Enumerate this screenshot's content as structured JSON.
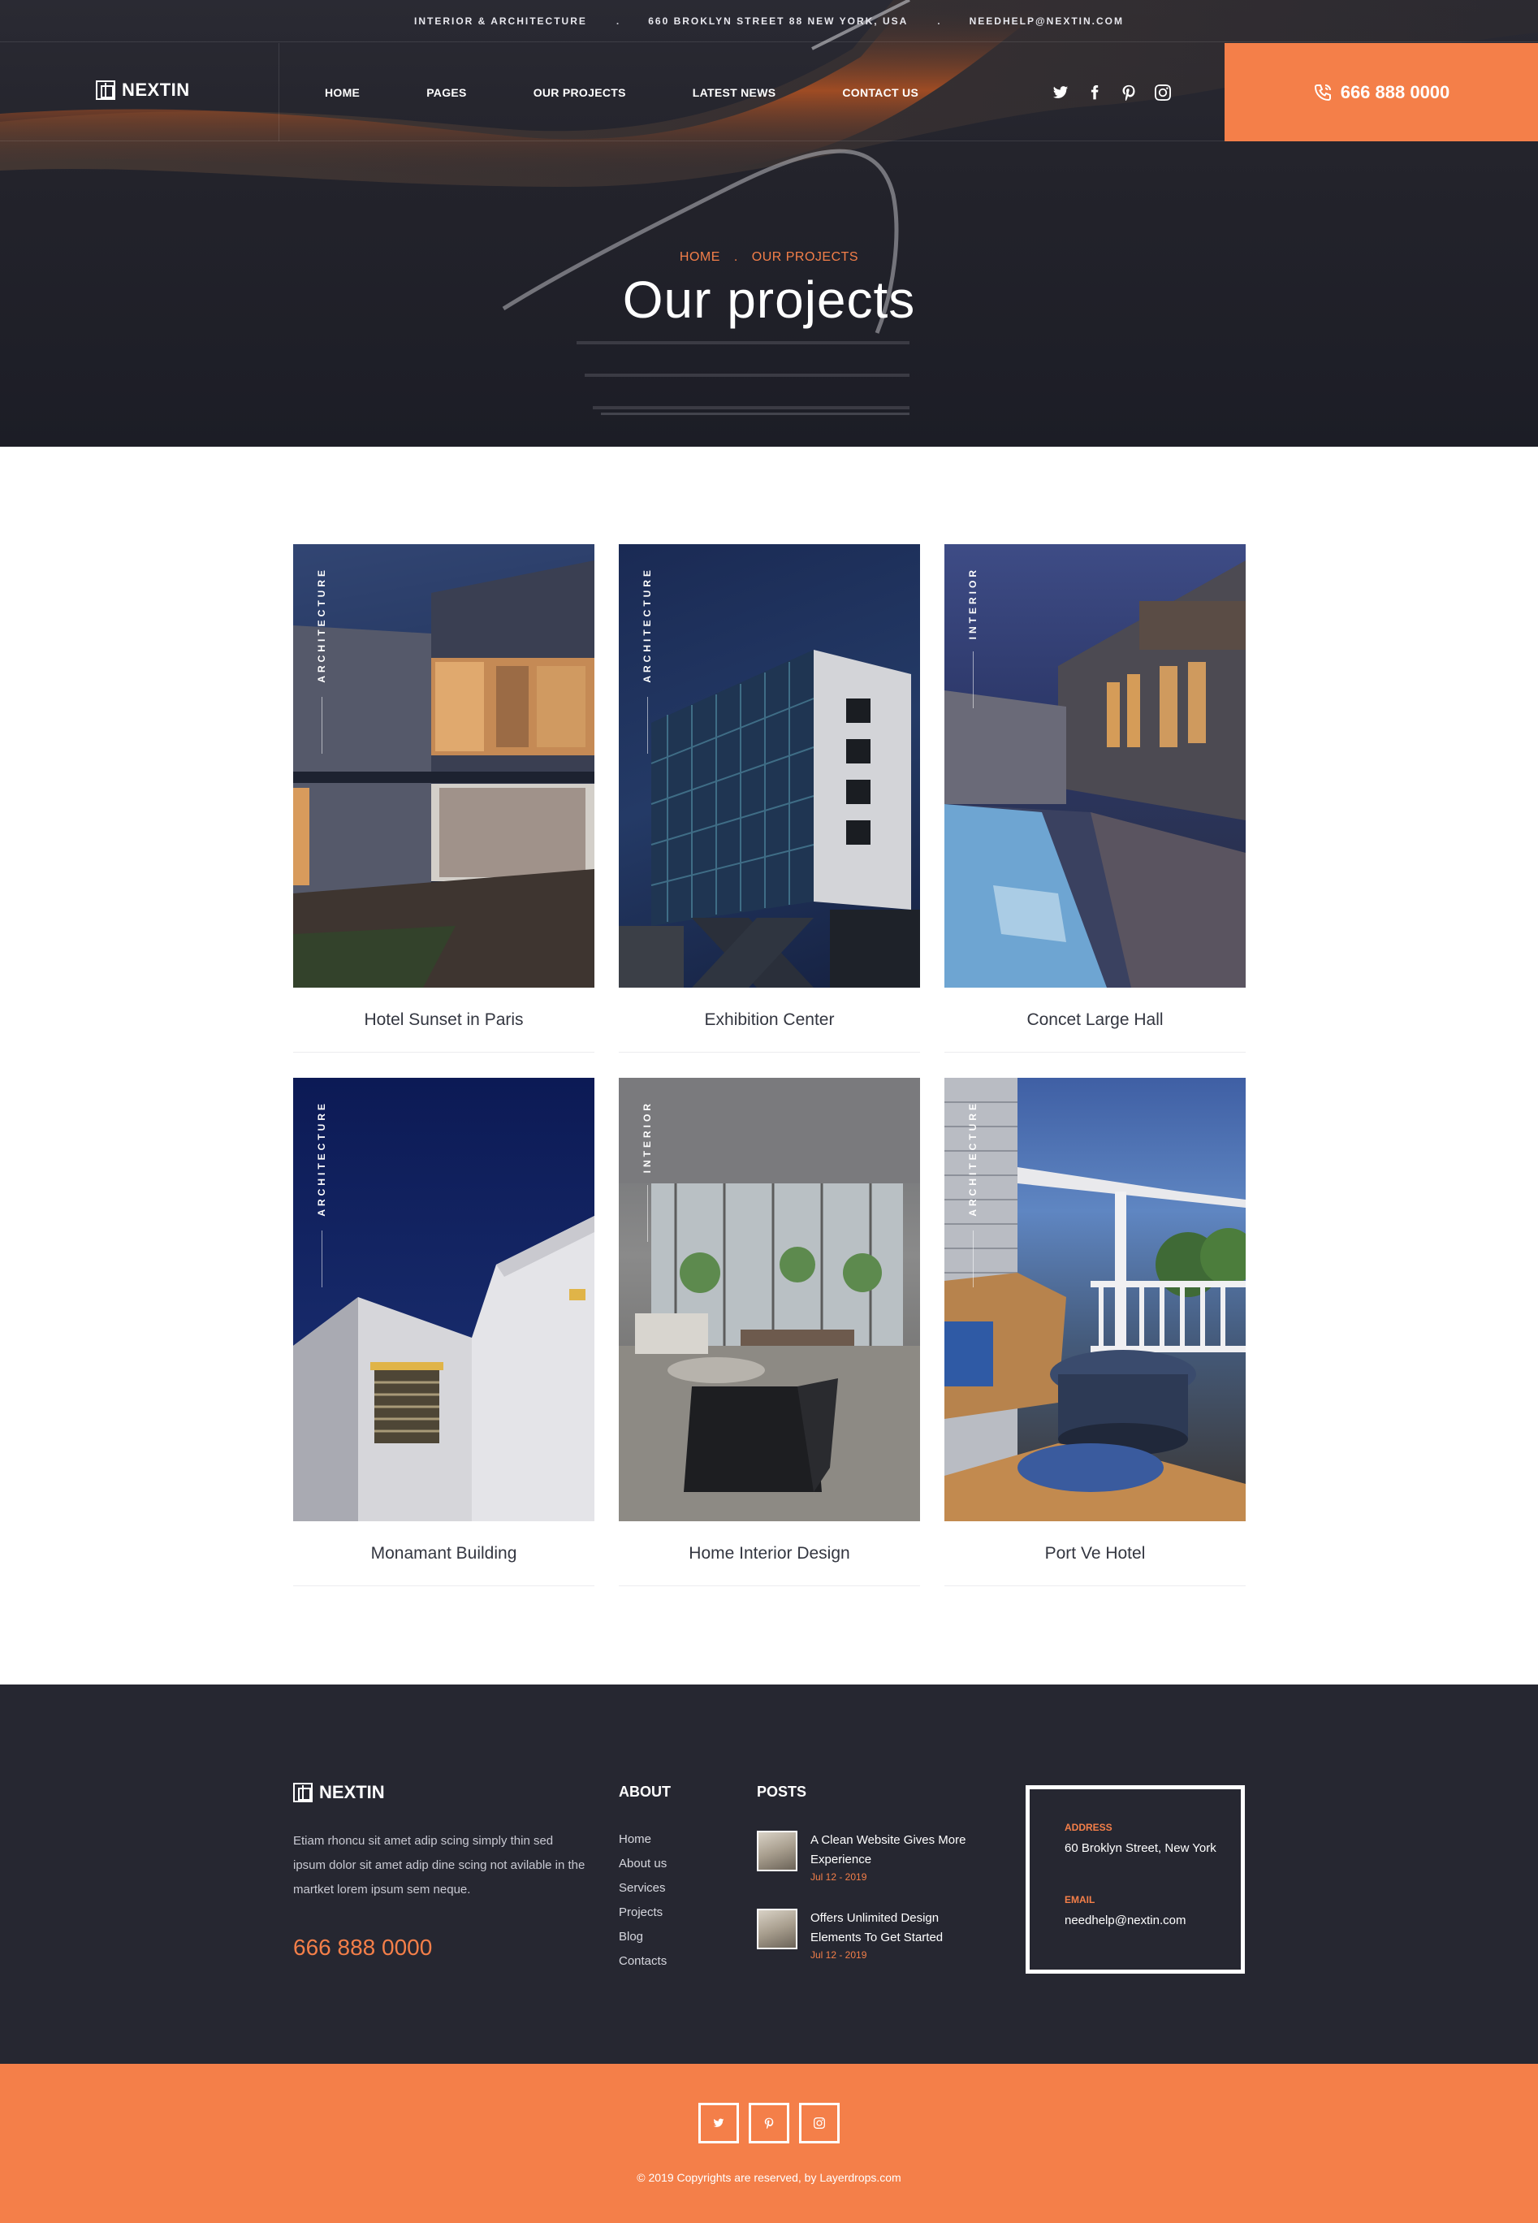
{
  "topbar": {
    "tagline": "INTERIOR & ARCHITECTURE",
    "address": "660 BROKLYN STREET 88 NEW YORK, USA",
    "email": "NEEDHELP@NEXTIN.COM",
    "separator": "."
  },
  "brand": {
    "name": "NEXTIN"
  },
  "nav": {
    "items": [
      {
        "label": "HOME"
      },
      {
        "label": "PAGES"
      },
      {
        "label": "OUR PROJECTS"
      },
      {
        "label": "LATEST NEWS"
      },
      {
        "label": "CONTACT US"
      }
    ],
    "socials": [
      "twitter-icon",
      "facebook-icon",
      "pinterest-icon",
      "instagram-icon"
    ],
    "phone": "666 888 0000"
  },
  "hero": {
    "breadcrumb": [
      "HOME",
      "OUR PROJECTS"
    ],
    "breadcrumb_separator": ".",
    "title": "Our projects"
  },
  "projects": [
    {
      "name": "Hotel Sunset in Paris",
      "category": "ARCHITECTURE"
    },
    {
      "name": "Exhibition Center",
      "category": "ARCHITECTURE"
    },
    {
      "name": "Concet Large Hall",
      "category": "INTERIOR"
    },
    {
      "name": "Monamant Building",
      "category": "ARCHITECTURE"
    },
    {
      "name": "Home Interior Design",
      "category": "INTERIOR"
    },
    {
      "name": "Port Ve Hotel",
      "category": "ARCHITECTURE"
    }
  ],
  "footer": {
    "brand": "NEXTIN",
    "about_text": "Etiam rhoncu sit amet adip scing simply thin sed ipsum dolor sit amet adip dine scing not avilable in the martket lorem ipsum sem neque.",
    "phone": "666 888 0000",
    "about_title": "ABOUT",
    "about_links": [
      "Home",
      "About us",
      "Services",
      "Projects",
      "Blog",
      "Contacts"
    ],
    "posts_title": "POSTS",
    "posts": [
      {
        "title": "A Clean Website Gives More Experience",
        "date": "Jul 12 - 2019"
      },
      {
        "title": "Offers Unlimited Design Elements To Get Started",
        "date": "Jul 12 - 2019"
      }
    ],
    "address_label": "ADDRESS",
    "address": "60 Broklyn Street, New York",
    "email_label": "EMAIL",
    "email": "needhelp@nextin.com"
  },
  "bottom": {
    "socials": [
      "twitter-icon",
      "pinterest-icon",
      "instagram-icon"
    ],
    "copyright": "© 2019 Copyrights are reserved, by Layerdrops.com"
  },
  "colors": {
    "accent": "#f47f49",
    "dark": "#262731",
    "hero_dark": "#1c1d26"
  }
}
